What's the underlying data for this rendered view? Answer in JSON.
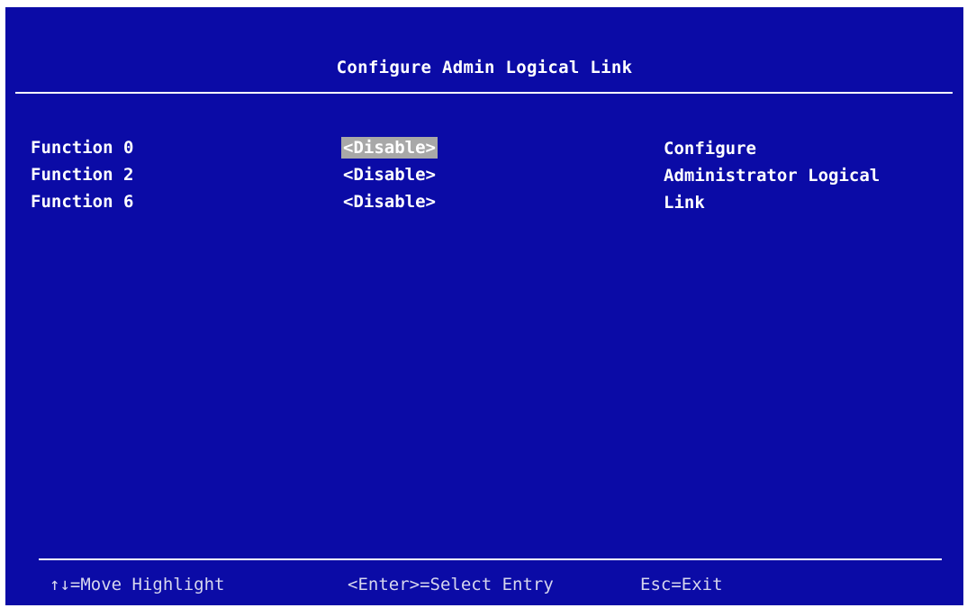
{
  "title": "Configure Admin Logical Link",
  "functions": [
    {
      "label": "Function 0",
      "value": "<Disable>",
      "selected": true
    },
    {
      "label": "Function 2",
      "value": "<Disable>",
      "selected": false
    },
    {
      "label": "Function 6",
      "value": "<Disable>",
      "selected": false
    }
  ],
  "help_text": [
    "Configure",
    "Administrator Logical",
    "Link"
  ],
  "footer": {
    "move": "↑↓=Move Highlight",
    "enter": "<Enter>=Select Entry",
    "esc": "Esc=Exit"
  },
  "colors": {
    "background": "#0b0ba6",
    "highlight": "#a8a8a8",
    "text": "#ffffff"
  }
}
